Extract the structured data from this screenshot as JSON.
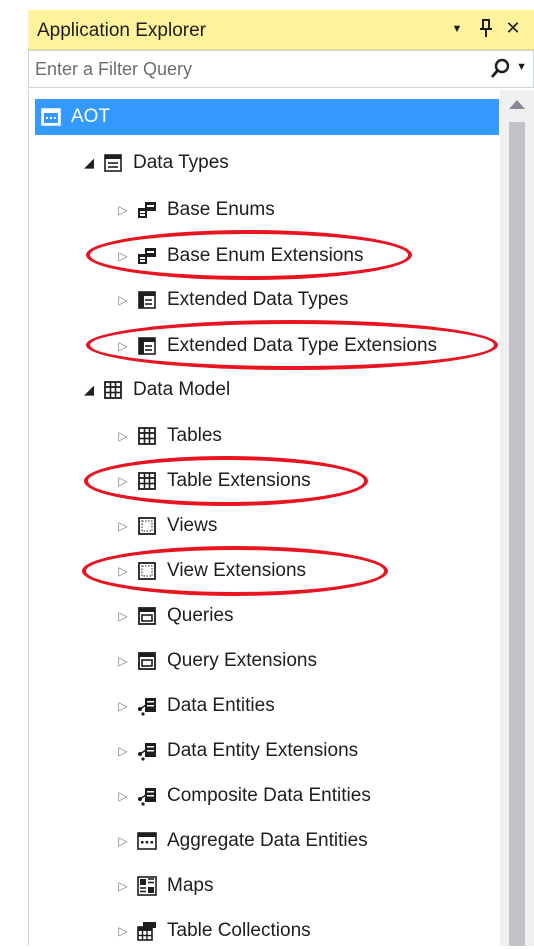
{
  "panel": {
    "title": "Application Explorer",
    "dropdown_glyph": "▼",
    "pin_glyph": "⊥",
    "close_glyph": "✕"
  },
  "filter": {
    "placeholder": "Enter a Filter Query",
    "search_icon": "search-icon",
    "dropdown_glyph": "▼"
  },
  "tree": {
    "root": {
      "label": "AOT",
      "icon": "aot-icon"
    },
    "data_types": {
      "label": "Data Types",
      "children": [
        {
          "label": "Base Enums",
          "icon": "base-enum-icon"
        },
        {
          "label": "Base Enum Extensions",
          "icon": "base-enum-icon"
        },
        {
          "label": "Extended Data Types",
          "icon": "edt-icon"
        },
        {
          "label": "Extended Data Type Extensions",
          "icon": "edt-icon"
        }
      ]
    },
    "data_model": {
      "label": "Data Model",
      "children": [
        {
          "label": "Tables",
          "icon": "table-icon"
        },
        {
          "label": "Table Extensions",
          "icon": "table-icon"
        },
        {
          "label": "Views",
          "icon": "view-icon"
        },
        {
          "label": "View Extensions",
          "icon": "view-icon"
        },
        {
          "label": "Queries",
          "icon": "query-icon"
        },
        {
          "label": "Query Extensions",
          "icon": "query-icon"
        },
        {
          "label": "Data Entities",
          "icon": "data-entity-icon"
        },
        {
          "label": "Data Entity Extensions",
          "icon": "data-entity-icon"
        },
        {
          "label": "Composite Data Entities",
          "icon": "data-entity-icon"
        },
        {
          "label": "Aggregate Data Entities",
          "icon": "aggregate-icon"
        },
        {
          "label": "Maps",
          "icon": "map-icon"
        },
        {
          "label": "Table Collections",
          "icon": "table-collection-icon"
        }
      ]
    }
  },
  "colors": {
    "title_bg": "#fff29d",
    "selection": "#3399ff",
    "annotation": "#e8141f"
  }
}
